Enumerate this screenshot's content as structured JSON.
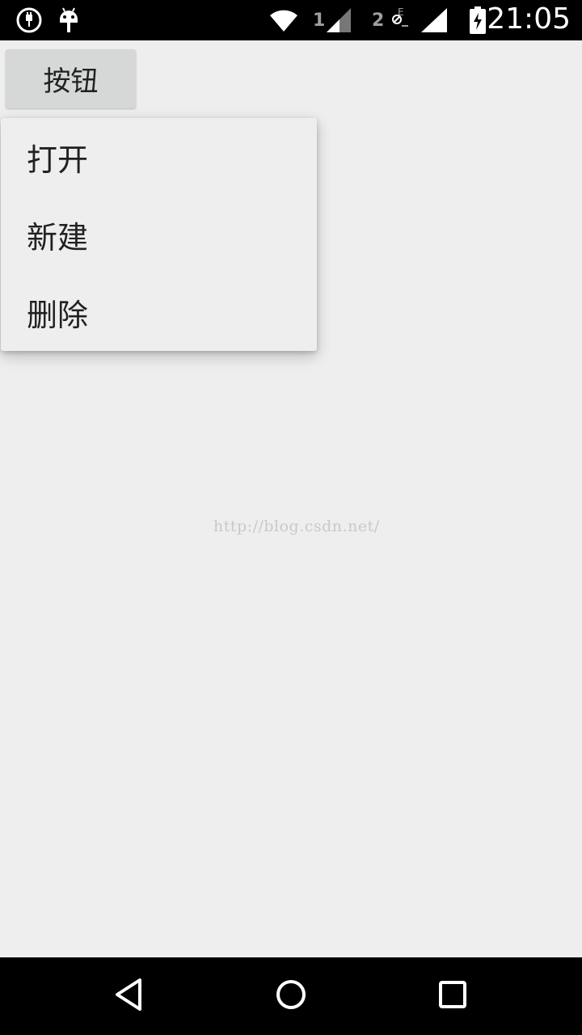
{
  "status_bar": {
    "time": "21:05",
    "sim1_label": "1",
    "sim2_label": "2",
    "icons": [
      "usb-icon",
      "android-icon",
      "wifi-icon",
      "signal-icon",
      "no-sim-icon",
      "signal-icon",
      "battery-charging-icon"
    ]
  },
  "main": {
    "button_label": "按钮"
  },
  "popup_menu": {
    "items": [
      {
        "label": "打开"
      },
      {
        "label": "新建"
      },
      {
        "label": "删除"
      }
    ]
  },
  "watermark": "http://blog.csdn.net/",
  "nav_bar": {
    "icons": [
      "back-icon",
      "home-icon",
      "recents-icon"
    ]
  },
  "colors": {
    "background": "#eeeeee",
    "bars": "#000000",
    "button": "#d6d7d7",
    "text": "#212121"
  }
}
